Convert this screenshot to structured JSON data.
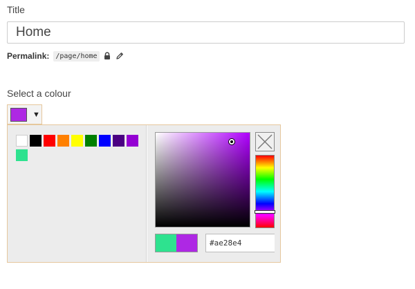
{
  "title_field": {
    "label": "Title",
    "value": "Home"
  },
  "permalink": {
    "label": "Permalink:",
    "path": "/page/home",
    "icons": [
      "lock-icon",
      "pencil-icon"
    ]
  },
  "colour_picker": {
    "label": "Select a colour",
    "selected_color": "#ae28e4",
    "caret": "▼",
    "palette": [
      {
        "name": "white",
        "color": "#ffffff"
      },
      {
        "name": "black",
        "color": "#000000"
      },
      {
        "name": "red",
        "color": "#ff0000"
      },
      {
        "name": "orange",
        "color": "#ff8000"
      },
      {
        "name": "yellow",
        "color": "#ffff00"
      },
      {
        "name": "green",
        "color": "#008000"
      },
      {
        "name": "blue",
        "color": "#0000ff"
      },
      {
        "name": "indigo",
        "color": "#4b0082"
      },
      {
        "name": "violet",
        "color": "#9400d3"
      },
      {
        "name": "mint",
        "color": "#2ee28f"
      }
    ],
    "compare": {
      "previous": "#2ee28f",
      "current": "#ae28e4"
    },
    "hex_value": "#ae28e4",
    "hue_color": "#b000ff",
    "close_icon": "close-icon"
  },
  "colors": {
    "popup_border": "#e6c79c",
    "popup_background": "#ececec"
  }
}
